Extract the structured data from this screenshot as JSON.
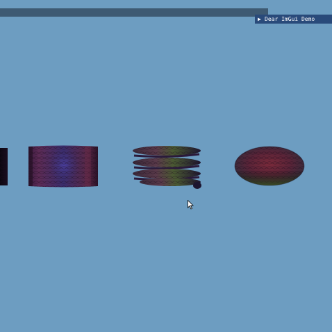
{
  "imgui": {
    "window_title": "Dear ImGui Demo",
    "collapsed": true,
    "arrow_icon": "triangle-right-icon"
  },
  "scene": {
    "background_color": "#6d9dc1",
    "objects": [
      {
        "name": "partial-cube",
        "shape": "cube"
      },
      {
        "name": "cylinder",
        "shape": "cylinder"
      },
      {
        "name": "spring",
        "shape": "helix"
      },
      {
        "name": "sphere",
        "shape": "ellipsoid"
      }
    ]
  },
  "colors": {
    "menu_strip": "#3e5a73",
    "window_title_bg": "#294a7a"
  }
}
